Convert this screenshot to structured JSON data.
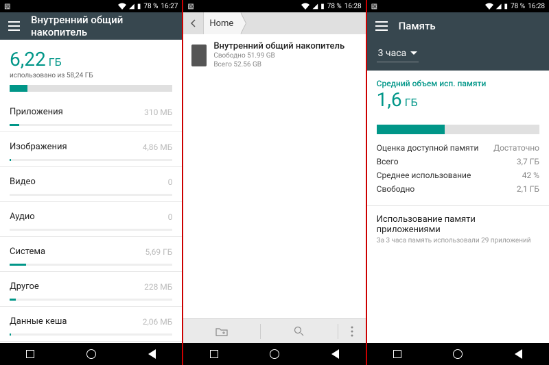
{
  "panel1": {
    "status": {
      "battery": "78 %",
      "time": "16:27"
    },
    "title": "Внутренний общий накопитель",
    "used_value": "6,22",
    "used_unit": "ГБ",
    "used_subtext": "использовано из 58,24 ГБ",
    "progress_pct": 11,
    "categories": [
      {
        "label": "Приложения",
        "value": "310 МБ",
        "bar": 6
      },
      {
        "label": "Изображения",
        "value": "4,86 МБ",
        "bar": 1
      },
      {
        "label": "Видео",
        "value": "0",
        "bar": 0
      },
      {
        "label": "Аудио",
        "value": "0",
        "bar": 0
      },
      {
        "label": "Система",
        "value": "5,69 ГБ",
        "bar": 10
      },
      {
        "label": "Другое",
        "value": "228 МБ",
        "bar": 4
      },
      {
        "label": "Данные кеша",
        "value": "2,06 МБ",
        "bar": 1
      }
    ]
  },
  "panel2": {
    "status": {
      "battery": "78 %",
      "time": "16:28"
    },
    "breadcrumb": {
      "home": "Home"
    },
    "item": {
      "title": "Внутренний общий накопитель",
      "free": "Свободно 51.99 GB",
      "total": "Всего 52.56 GB"
    },
    "toolbar": {
      "folder": "folder",
      "search": "search",
      "menu": "menu"
    }
  },
  "panel3": {
    "status": {
      "battery": "78 %",
      "time": "16:28"
    },
    "title": "Память",
    "dropdown": "3 часа",
    "avg_label": "Средний объем исп. памяти",
    "avg_value": "1,6",
    "avg_unit": "ГБ",
    "progress_pct": 42,
    "stats": [
      {
        "label": "Оценка доступной памяти",
        "value": "Достаточно"
      },
      {
        "label": "Всего",
        "value": "3,7 ГБ"
      },
      {
        "label": "Среднее использование",
        "value": "42 %"
      },
      {
        "label": "Свободно",
        "value": "2,1 ГБ"
      }
    ],
    "apps": {
      "title": "Использование памяти приложениями",
      "sub": "За 3 часа память использовали 29 приложений"
    }
  }
}
